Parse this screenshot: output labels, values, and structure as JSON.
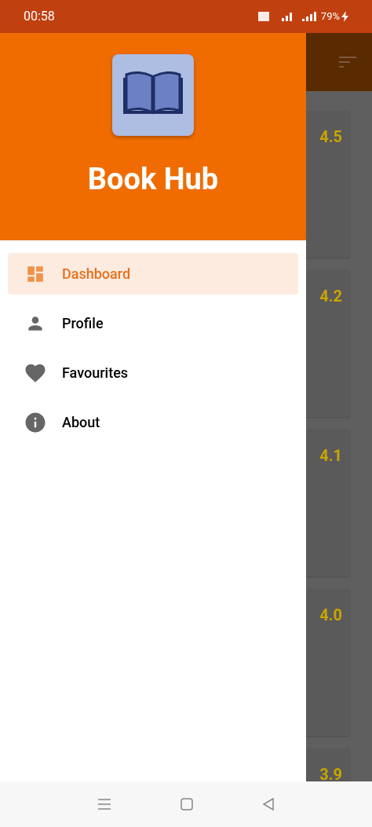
{
  "status_bar": {
    "time": "00:58",
    "battery": "79%"
  },
  "drawer": {
    "title": "Book Hub",
    "items": [
      {
        "label": "Dashboard",
        "kind": "dashboard",
        "selected": true
      },
      {
        "label": "Profile",
        "kind": "person",
        "selected": false
      },
      {
        "label": "Favourites",
        "kind": "heart",
        "selected": false
      },
      {
        "label": "About",
        "kind": "info",
        "selected": false
      }
    ]
  },
  "books": [
    {
      "rating": "4.5"
    },
    {
      "rating": "4.2"
    },
    {
      "rating": "4.1"
    },
    {
      "rating": "4.0"
    },
    {
      "rating": "3.9"
    }
  ]
}
